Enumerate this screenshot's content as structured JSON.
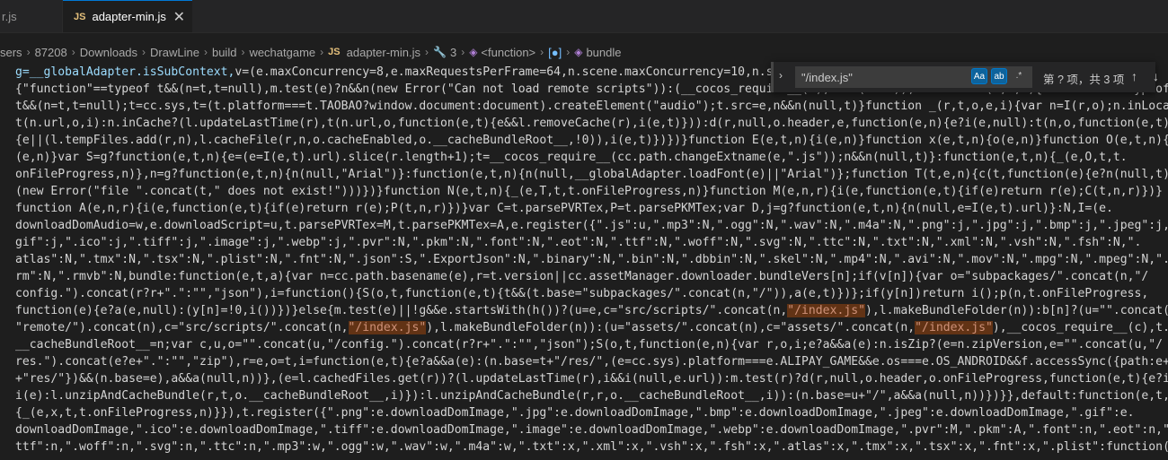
{
  "tabs": {
    "inactive_label": "r.js",
    "active_badge": "JS",
    "active_label": "adapter-min.js",
    "close_glyph": "✕"
  },
  "breadcrumb": {
    "items": [
      "sers",
      "87208",
      "Downloads",
      "DrawLine",
      "build",
      "wechatgame"
    ],
    "file_badge": "JS",
    "file": "adapter-min.js",
    "symbol_number": "3",
    "symbol_function": "<function>",
    "symbol_bracket": "[●]",
    "symbol_bundle": "bundle"
  },
  "find_widget": {
    "query": "\"/index.js\"",
    "match_case": "Aa",
    "whole_word": "ab",
    "regex": ".*",
    "result_count": "第 ? 项，共 3 项",
    "icons": {
      "toggle_replace": "chevron-right-icon",
      "prev": "arrow-up-icon",
      "next": "arrow-down-icon",
      "in_selection": "list-icon",
      "close": "close-icon"
    }
  },
  "code": {
    "line_0_a": "g=__globalAdapter.isSubContext,",
    "line_0_b": "v=(e.maxConcurrency=8,e.maxRequestsPerFrame=64,n.scene.maxConcurrency=10,n.scen",
    "line_1": "{\"function\"==typeof t&&(n=t,t=null),m.test(e)?n&&n(new Error(\"Can not load remote scripts\")):(__cocos_require__(c),null(null)),function w(e,t,n){\"function\"==typeof",
    "line_2": "t&&(n=t,t=null);t=cc.sys,t=(t.platform===t.TAOBAO?window.document:document).createElement(\"audio\");t.src=e,n&&n(null,t)}function _(r,t,o,e,i){var n=I(r,o);n.inLocal?",
    "line_3": "t(n.url,o,i):n.inCache?(l.updateLastTime(r),t(n.url,o,function(e,t){e&&l.removeCache(r),i(e,t)})):d(r,null,o.header,e,function(e,n){e?i(e,null):t(n,o,function(e,t)",
    "line_4": "{e||(l.tempFiles.add(r,n),l.cacheFile(r,n,o.cacheEnabled,o.__cacheBundleRoot__,!0)),i(e,t)})})}function E(e,t,n){i(e,n)}function x(e,t,n){o(e,n)}function O(e,t,n){a",
    "line_5": "(e,n)}var S=g?function(e,t,n){e=(e=I(e,t).url).slice(r.length+1);t=__cocos_require__(cc.path.changeExtname(e,\".js\"));n&&n(null,t)}:function(e,t,n){_(e,O,t,t.",
    "line_6": "onFileProgress,n)},n=g?function(e,t,n){n(null,\"Arial\")}:function(e,t,n){n(null,__globalAdapter.loadFont(e)||\"Arial\")};function T(t,e,n){c(t,function(e){e?n(null,t):n",
    "line_7": "(new Error(\"file \".concat(t,\" does not exist!\")))})}function N(e,t,n){_(e,T,t,t.onFileProgress,n)}function M(e,n,r){i(e,function(e,t){if(e)return r(e);C(t,n,r)})}",
    "line_8": "function A(e,n,r){i(e,function(e,t){if(e)return r(e);P(t,n,r)})}var C=t.parsePVRTex,P=t.parsePKMTex;var D,j=g?function(e,t,n){n(null,e=I(e,t).url)}:N,I=(e.",
    "line_9": "downloadDomAudio=w,e.downloadScript=u,t.parsePVRTex=M,t.parsePKMTex=A,e.register({\".js\":u,\".mp3\":N,\".ogg\":N,\".wav\":N,\".m4a\":N,\".png\":j,\".jpg\":j,\".bmp\":j,\".jpeg\":j,\".",
    "line_10": "gif\":j,\".ico\":j,\".tiff\":j,\".image\":j,\".webp\":j,\".pvr\":N,\".pkm\":N,\".font\":N,\".eot\":N,\".ttf\":N,\".woff\":N,\".svg\":N,\".ttc\":N,\".txt\":N,\".xml\":N,\".vsh\":N,\".fsh\":N,\".",
    "line_11": "atlas\":N,\".tmx\":N,\".tsx\":N,\".plist\":N,\".fnt\":N,\".json\":S,\".ExportJson\":N,\".binary\":N,\".bin\":N,\".dbbin\":N,\".skel\":N,\".mp4\":N,\".avi\":N,\".mov\":N,\".mpg\":N,\".mpeg\":N,\".",
    "line_12": "rm\":N,\".rmvb\":N,bundle:function(e,t,a){var n=cc.path.basename(e),r=t.version||cc.assetManager.downloader.bundleVers[n];if(v[n]){var o=\"subpackages/\".concat(n,\"/",
    "line_13": "config.\").concat(r?r+\".\":\"\",\"json\"),i=function(){S(o,t,function(e,t){t&&(t.base=\"subpackages/\".concat(n,\"/\")),a(e,t)})};if(y[n])return i();p(n,t.onFileProgress,",
    "line_14_a": "function(e){e?a(e,null):(y[n]=!0,i())})}else{m.test(e)||!g&&e.startsWith(h())?(u=e,c=\"src/scripts/\".concat(n,",
    "line_14_m": "\"/index.js\"",
    "line_14_b": "),l.makeBundleFolder(n)):b[n]?(u=\"\".concat(s,",
    "line_15_a": "\"remote/\").concat(n),c=\"src/scripts/\".concat(n,",
    "line_15_m1": "\"/index.js\"",
    "line_15_b": "),l.makeBundleFolder(n)):(u=\"assets/\".concat(n),c=\"assets/\".concat(n,",
    "line_15_m2": "\"/index.js\"",
    "line_15_c": "),__cocos_require__(c),t.",
    "line_16": "__cacheBundleRoot__=n;var c,u,o=\"\".concat(u,\"/config.\").concat(r?r+\".\":\"\",\"json\");S(o,t,function(e,n){var r,o,i;e?a&&a(e):n.isZip?(e=n.zipVersion,e=\"\".concat(u,\"/",
    "line_17": "res.\").concat(e?e+\".\":\"\",\"zip\"),r=e,o=t,i=function(e,t){e?a&&a(e):(n.base=t+\"/res/\",(e=cc.sys).platform===e.ALIPAY_GAME&&e.os===e.OS_ANDROID&&f.accessSync({path:e+t",
    "line_18": "+\"res/\"})&&(n.base=e),a&&a(null,n))},(e=l.cachedFiles.get(r))?(l.updateLastTime(r),i&&i(null,e.url)):m.test(r)?d(r,null,o.header,o.onFileProgress,function(e,t){e?i&&",
    "line_19": "i(e):l.unzipAndCacheBundle(r,t,o.__cacheBundleRoot__,i)}):l.unzipAndCacheBundle(r,r,o.__cacheBundleRoot__,i)):(n.base=u+\"/\",a&&a(null,n))})}},default:function(e,t,n)",
    "line_20": "{_(e,x,t,t.onFileProgress,n)}}),t.register({\".png\":e.downloadDomImage,\".jpg\":e.downloadDomImage,\".bmp\":e.downloadDomImage,\".jpeg\":e.downloadDomImage,\".gif\":e.",
    "line_21": "downloadDomImage,\".ico\":e.downloadDomImage,\".tiff\":e.downloadDomImage,\".image\":e.downloadDomImage,\".webp\":e.downloadDomImage,\".pvr\":M,\".pkm\":A,\".font\":n,\".eot\":n,\".",
    "line_22": "ttf\":n,\".woff\":n,\".svg\":n,\".ttc\":n,\".mp3\":w,\".ogg\":w,\".wav\":w,\".m4a\":w,\".txt\":x,\".xml\":x,\".vsh\":x,\".fsh\":x,\".atlas\":x,\".tmx\":x,\".tsx\":x,\".fnt\":x,\".plist\":function(e,"
  }
}
